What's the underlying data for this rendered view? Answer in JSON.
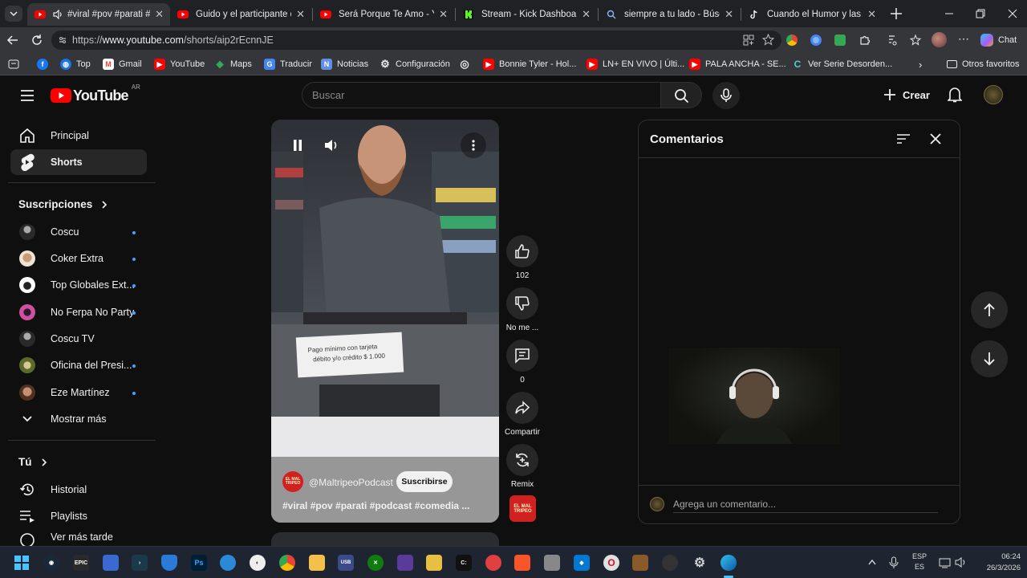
{
  "browser": {
    "tabs": [
      {
        "title": "#viral #pov #parati #pod",
        "active": true,
        "icon": "youtube-icon"
      },
      {
        "title": "Guido y el participante que e",
        "active": false,
        "icon": "youtube-icon"
      },
      {
        "title": "Será Porque Te Amo - YouTub",
        "active": false,
        "icon": "youtube-icon"
      },
      {
        "title": "Stream - Kick Dashboard",
        "active": false,
        "icon": "kick-icon"
      },
      {
        "title": "siempre a tu lado - Búsqueda",
        "active": false,
        "icon": "search-icon"
      },
      {
        "title": "Cuando el Humor y las Mater",
        "active": false,
        "icon": "tiktok-icon"
      }
    ],
    "url_prefix": "https://",
    "url_host": "www.youtube.com",
    "url_path": "/shorts/aip2rEcnnJE",
    "chat_label": "Chat",
    "bookmarks": [
      {
        "label": "",
        "icon": "facebook-icon"
      },
      {
        "label": "Top",
        "icon": "globe-icon"
      },
      {
        "label": "Gmail",
        "icon": "gmail-icon"
      },
      {
        "label": "YouTube",
        "icon": "youtube-icon"
      },
      {
        "label": "Maps",
        "icon": "maps-icon"
      },
      {
        "label": "Traducir",
        "icon": "translate-icon"
      },
      {
        "label": "Noticias",
        "icon": "news-icon"
      },
      {
        "label": "Configuración",
        "icon": "gear-icon"
      },
      {
        "label": "",
        "icon": "globe-icon"
      },
      {
        "label": "Bonnie Tyler - Hol...",
        "icon": "youtube-icon"
      },
      {
        "label": "LN+ EN VIVO | Últi...",
        "icon": "youtube-icon"
      },
      {
        "label": "PALA ANCHA - SE...",
        "icon": "youtube-icon"
      },
      {
        "label": "Ver Serie Desorden...",
        "icon": "c-icon"
      }
    ],
    "other_bookmarks": "Otros favoritos"
  },
  "youtube": {
    "logo_text": "YouTube",
    "region": "AR",
    "search_placeholder": "Buscar",
    "create_label": "Crear",
    "sidebar": {
      "main": [
        {
          "label": "Principal",
          "icon": "home-icon"
        },
        {
          "label": "Shorts",
          "icon": "shorts-icon",
          "selected": true
        }
      ],
      "subscriptions_title": "Suscripciones",
      "subscriptions": [
        {
          "label": "Coscu",
          "dot": true,
          "color": "#2a2a2a"
        },
        {
          "label": "Coker Extra",
          "dot": true,
          "color": "#e8d6c0"
        },
        {
          "label": "Top Globales Ext...",
          "dot": true,
          "color": "#ffffff"
        },
        {
          "label": "No Ferpa No Party",
          "dot": true,
          "color": "#d050a0"
        },
        {
          "label": "Coscu TV",
          "dot": false,
          "color": "#2a2a2a"
        },
        {
          "label": "Oficina del Presi...",
          "dot": true,
          "color": "#6b7a3a"
        },
        {
          "label": "Eze Martínez",
          "dot": true,
          "color": "#b07050"
        }
      ],
      "show_more": "Mostrar más",
      "you_title": "Tú",
      "you_items": [
        {
          "label": "Historial",
          "icon": "history-icon"
        },
        {
          "label": "Playlists",
          "icon": "playlist-icon"
        },
        {
          "label": "Ver más tarde",
          "icon": "clock-icon"
        }
      ]
    },
    "short": {
      "channel": "@MaltripeoPodcast",
      "subscribe_label": "Suscribirse",
      "title": "#viral #pov #parati #podcast #comedia ...",
      "sign_text": "Pago mínimo con tarjeta débito y/o crédito $ 1.000",
      "channel_logo_text": "EL MAL TRIPEO",
      "actions": [
        {
          "label": "102",
          "icon": "like-icon"
        },
        {
          "label": "No me ...",
          "icon": "dislike-icon"
        },
        {
          "label": "0",
          "icon": "comment-icon"
        },
        {
          "label": "Compartir",
          "icon": "share-icon"
        },
        {
          "label": "Remix",
          "icon": "remix-icon"
        }
      ]
    },
    "comments": {
      "title": "Comentarios",
      "placeholder": "Agrega un comentario..."
    }
  },
  "taskbar": {
    "lang_top": "ESP",
    "lang_bottom": "ES",
    "time": "06:24",
    "date": "26/3/2026"
  }
}
